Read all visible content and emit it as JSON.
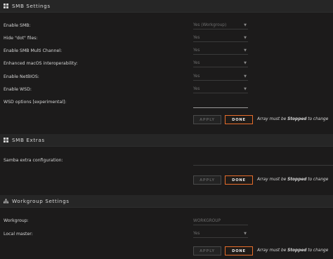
{
  "smb_settings": {
    "title": "SMB Settings",
    "rows": [
      {
        "label": "Enable SMB:",
        "value": "Yes (Workgroup)"
      },
      {
        "label": "Hide \"dot\" files:",
        "value": "Yes"
      },
      {
        "label": "Enable SMB Multi Channel:",
        "value": "Yes"
      },
      {
        "label": "Enhanced macOS interoperability:",
        "value": "Yes"
      },
      {
        "label": "Enable NetBIOS:",
        "value": "Yes"
      },
      {
        "label": "Enable WSD:",
        "value": "Yes"
      }
    ],
    "wsd_options_label": "WSD options [experimental]:",
    "wsd_options_value": ""
  },
  "smb_extras": {
    "title": "SMB Extras",
    "extra_config_label": "Samba extra configuration:",
    "extra_config_value": ""
  },
  "workgroup_settings": {
    "title": "Workgroup Settings",
    "workgroup_label": "Workgroup:",
    "workgroup_placeholder": "WORKGROUP",
    "local_master_label": "Local master:",
    "local_master_value": "Yes"
  },
  "buttons": {
    "apply": "APPLY",
    "done": "DONE"
  },
  "array_note": {
    "prefix": "Array must be ",
    "bold": "Stopped",
    "suffix": " to change"
  },
  "colors": {
    "background": "#1c1b1b",
    "header": "#262626",
    "accent": "#e76d2b"
  },
  "icons": {
    "smb": "windows-icon",
    "extras": "windows-icon",
    "workgroup": "network-icon"
  }
}
